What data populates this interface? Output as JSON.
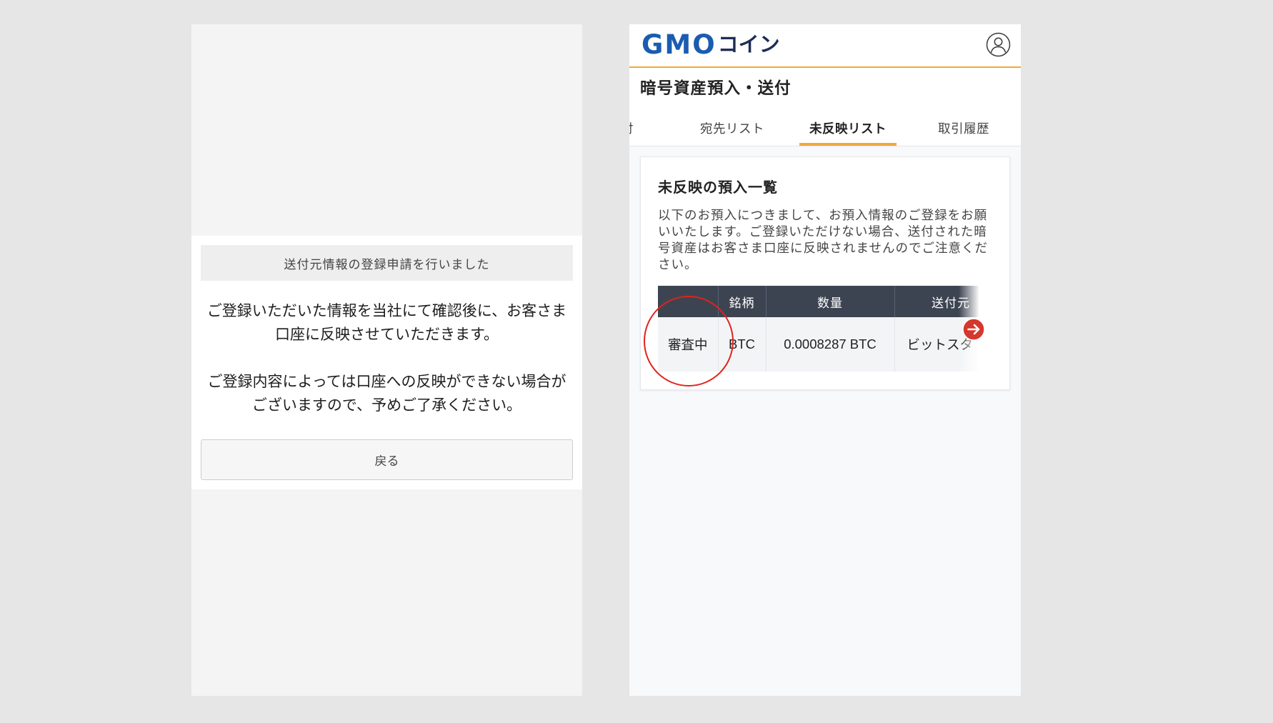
{
  "colors": {
    "page_background": "#e6e6e6",
    "accent_orange": "#f1a93b",
    "brand_blue": "#1a5cb0",
    "brand_navy": "#1d2d55",
    "table_header": "#3d4451",
    "annotation_red": "#e0231c",
    "arrow_red": "#d5382c"
  },
  "left_screen": {
    "modal": {
      "header": "送付元情報の登録申請を行いました",
      "paragraphs": [
        {
          "lines": [
            "ご登録いただいた情報を当社にて確認後に、お客さま",
            "口座に反映させていただきます。"
          ]
        },
        {
          "lines": [
            "ご登録内容によっては口座への反映ができない場合が",
            "ございますので、予めご了承ください。"
          ]
        }
      ],
      "back_button": "戻る"
    }
  },
  "right_screen": {
    "header": {
      "logo": {
        "latin": "GMO",
        "kana": "コイン"
      }
    },
    "icons": {
      "user": "user-account-icon",
      "table_scroll": "arrow-right-circle-icon"
    },
    "page_title": "暗号資産預入・送付",
    "tabs": [
      {
        "label": "付",
        "active": false
      },
      {
        "label": "宛先リスト",
        "active": false
      },
      {
        "label": "未反映リスト",
        "active": true
      },
      {
        "label": "取引履歴",
        "active": false
      }
    ],
    "card": {
      "title": "未反映の預入一覧",
      "description_lines": [
        "以下のお預入につきまして、お預入情報のご登録をお願",
        "いいたします。ご登録いただけない場合、送付された暗",
        "号資産はお客さま口座に反映されませんのでご注意くだ",
        "さい。"
      ],
      "table": {
        "headers": [
          "",
          "銘柄",
          "数量",
          "送付元"
        ],
        "rows": [
          [
            "審査中",
            "BTC",
            "0.0008287 BTC",
            "ビットスタ"
          ]
        ]
      }
    }
  }
}
